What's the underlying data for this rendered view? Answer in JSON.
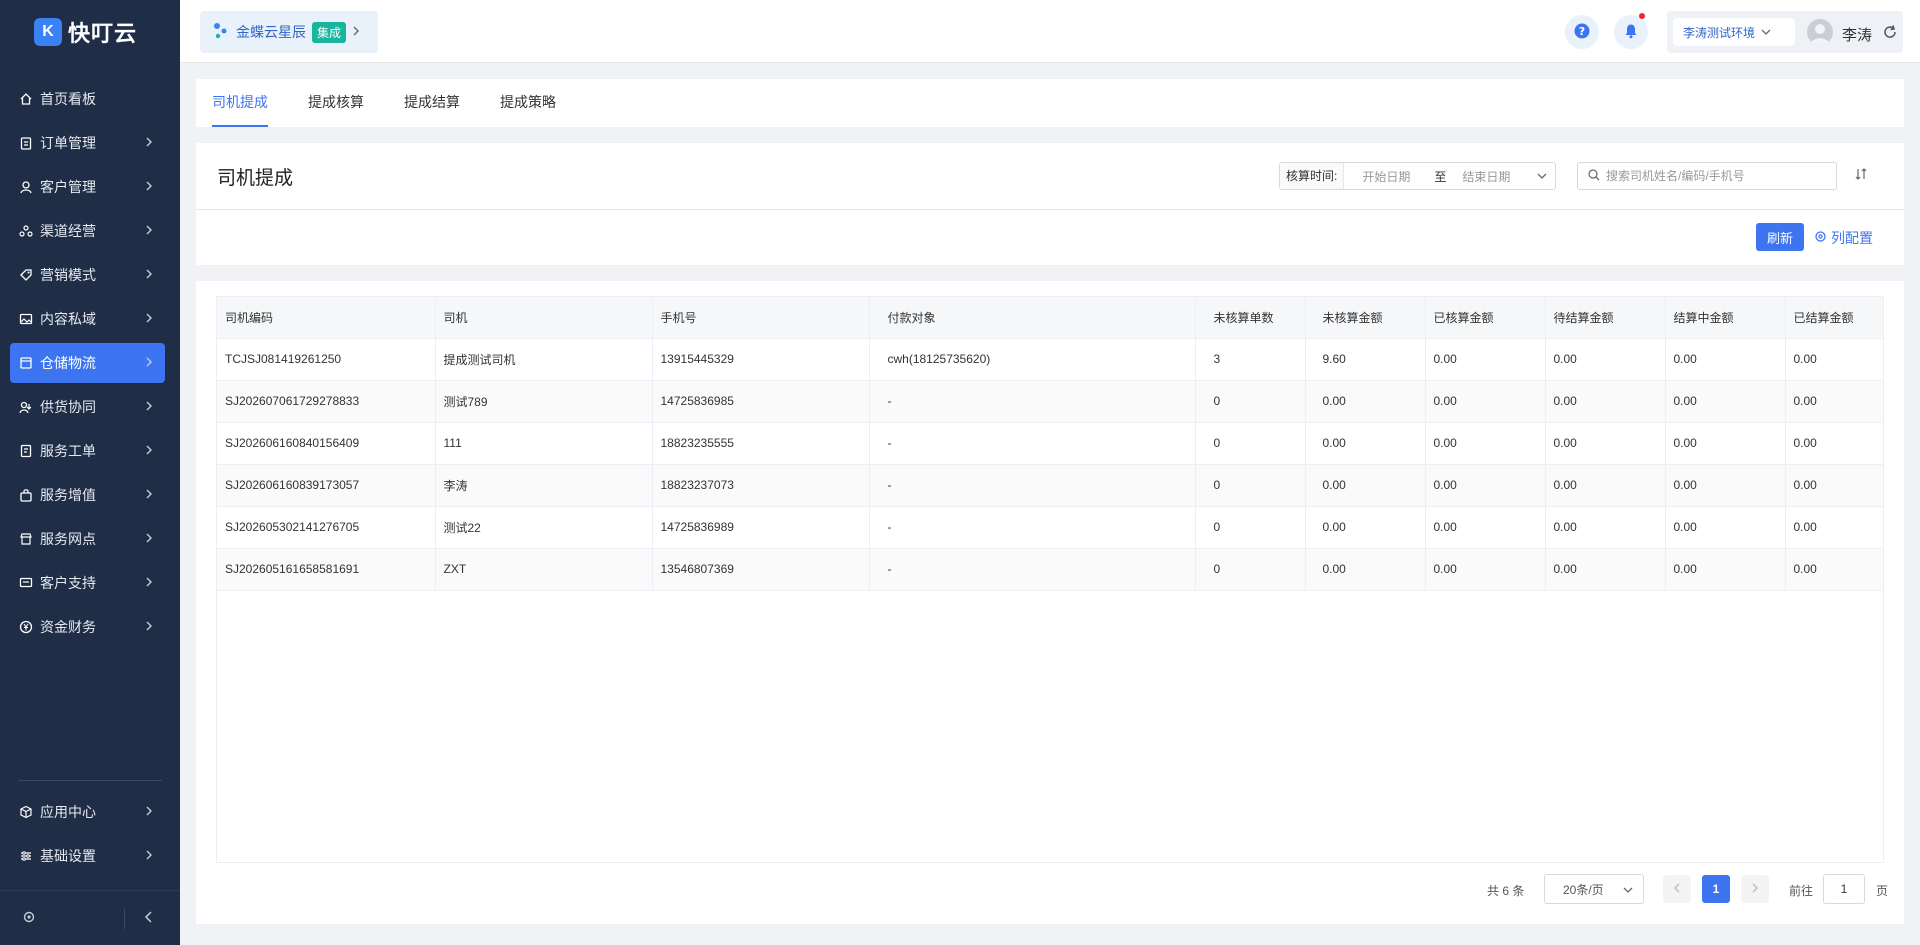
{
  "brand": {
    "logo_letter": "K",
    "name": "快叮云"
  },
  "sidebar": {
    "items": [
      {
        "label": "首页看板",
        "icon": "home-icon",
        "arrow": false,
        "active": false
      },
      {
        "label": "订单管理",
        "icon": "clipboard-icon",
        "arrow": true,
        "active": false
      },
      {
        "label": "客户管理",
        "icon": "user-icon",
        "arrow": true,
        "active": false
      },
      {
        "label": "渠道经营",
        "icon": "channel-icon",
        "arrow": true,
        "active": false
      },
      {
        "label": "营销模式",
        "icon": "tag-icon",
        "arrow": true,
        "active": false
      },
      {
        "label": "内容私域",
        "icon": "image-icon",
        "arrow": true,
        "active": false
      },
      {
        "label": "仓储物流",
        "icon": "box-icon",
        "arrow": true,
        "active": true
      },
      {
        "label": "供货协同",
        "icon": "supply-icon",
        "arrow": true,
        "active": false
      },
      {
        "label": "服务工单",
        "icon": "ticket-icon",
        "arrow": true,
        "active": false
      },
      {
        "label": "服务增值",
        "icon": "bag-icon",
        "arrow": true,
        "active": false
      },
      {
        "label": "服务网点",
        "icon": "store-icon",
        "arrow": true,
        "active": false
      },
      {
        "label": "客户支持",
        "icon": "support-icon",
        "arrow": true,
        "active": false
      },
      {
        "label": "资金财务",
        "icon": "yen-icon",
        "arrow": true,
        "active": false
      }
    ],
    "bottom_items": [
      {
        "label": "应用中心",
        "icon": "cube-icon"
      },
      {
        "label": "基础设置",
        "icon": "sliders-icon"
      }
    ]
  },
  "topbar": {
    "integration": {
      "name": "金蝶云星辰",
      "badge": "集成"
    },
    "env": "李涛测试环境",
    "user": "李涛"
  },
  "tabs": [
    {
      "label": "司机提成",
      "active": true
    },
    {
      "label": "提成核算",
      "active": false
    },
    {
      "label": "提成结算",
      "active": false
    },
    {
      "label": "提成策略",
      "active": false
    }
  ],
  "header": {
    "title": "司机提成",
    "date_label": "核算时间:",
    "date_start": "开始日期",
    "date_sep": "至",
    "date_end": "结束日期",
    "search_placeholder": "搜索司机姓名/编码/手机号",
    "refresh": "刷新",
    "column_config": "列配置"
  },
  "table": {
    "columns": [
      "司机编码",
      "司机",
      "手机号",
      "付款对象",
      "未核算单数",
      "未核算金额",
      "已核算金额",
      "待结算金额",
      "结算中金额",
      "已结算金额"
    ],
    "rows": [
      [
        "TCJSJ081419261250",
        "提成测试司机",
        "13915445329",
        "cwh(18125735620)",
        "3",
        "9.60",
        "0.00",
        "0.00",
        "0.00",
        "0.00"
      ],
      [
        "SJ202607061729278833",
        "测试789",
        "14725836985",
        "-",
        "0",
        "0.00",
        "0.00",
        "0.00",
        "0.00",
        "0.00"
      ],
      [
        "SJ202606160840156409",
        "111",
        "18823235555",
        "-",
        "0",
        "0.00",
        "0.00",
        "0.00",
        "0.00",
        "0.00"
      ],
      [
        "SJ202606160839173057",
        "李涛",
        "18823237073",
        "-",
        "0",
        "0.00",
        "0.00",
        "0.00",
        "0.00",
        "0.00"
      ],
      [
        "SJ202605302141276705",
        "测试22",
        "14725836989",
        "-",
        "0",
        "0.00",
        "0.00",
        "0.00",
        "0.00",
        "0.00"
      ],
      [
        "SJ202605161658581691",
        "ZXT",
        "13546807369",
        "-",
        "0",
        "0.00",
        "0.00",
        "0.00",
        "0.00",
        "0.00"
      ]
    ]
  },
  "pagination": {
    "total": "共 6 条",
    "page_size": "20条/页",
    "current": "1",
    "goto_label": "前往",
    "goto_value": "1",
    "goto_suffix": "页"
  },
  "colors": {
    "accent": "#3d75f0",
    "sidebar_bg": "#1f2d47",
    "badge": "#19b59c",
    "notify_dot": "#f5222d"
  }
}
